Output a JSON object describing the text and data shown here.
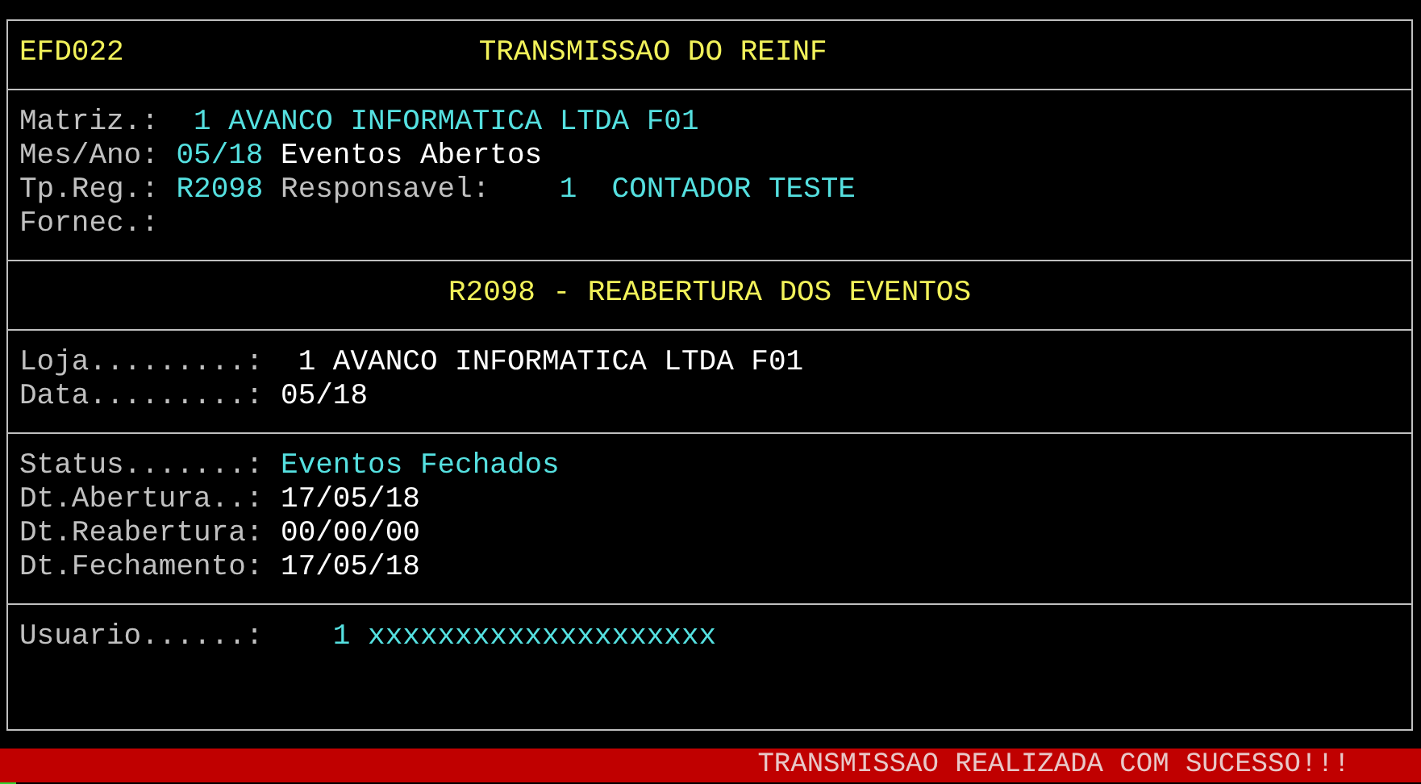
{
  "header": {
    "program_code": "EFD022",
    "title": "TRANSMISSAO DO REINF"
  },
  "sections": [
    {
      "kind": "fields",
      "lines": [
        {
          "segments": [
            {
              "kind": "label",
              "text": "Matriz.:"
            },
            {
              "kind": "highlight",
              "text": " 1 AVANCO INFORMATICA LTDA F01"
            }
          ]
        },
        {
          "segments": [
            {
              "kind": "label",
              "text": "Mes/Ano:"
            },
            {
              "kind": "highlight",
              "text": "05/18"
            },
            {
              "kind": "value",
              "text": "Eventos Abertos"
            }
          ]
        },
        {
          "segments": [
            {
              "kind": "label",
              "text": "Tp.Reg.:"
            },
            {
              "kind": "highlight",
              "text": "R2098"
            },
            {
              "kind": "label",
              "text": "Responsavel:"
            },
            {
              "kind": "highlight",
              "text": "   1  CONTADOR TESTE"
            }
          ]
        },
        {
          "segments": [
            {
              "kind": "label",
              "text": "Fornec.:"
            }
          ]
        }
      ]
    },
    {
      "kind": "heading",
      "text": "R2098 - REABERTURA DOS EVENTOS"
    },
    {
      "kind": "fields",
      "lines": [
        {
          "segments": [
            {
              "kind": "label",
              "text": "Loja.........:"
            },
            {
              "kind": "value",
              "text": " 1 AVANCO INFORMATICA LTDA F01"
            }
          ]
        },
        {
          "segments": [
            {
              "kind": "label",
              "text": "Data.........:"
            },
            {
              "kind": "value",
              "text": "05/18"
            }
          ]
        }
      ]
    },
    {
      "kind": "fields",
      "lines": [
        {
          "segments": [
            {
              "kind": "label",
              "text": "Status.......:"
            },
            {
              "kind": "highlight",
              "text": "Eventos Fechados"
            }
          ]
        },
        {
          "segments": [
            {
              "kind": "label",
              "text": "Dt.Abertura..:"
            },
            {
              "kind": "value",
              "text": "17/05/18"
            }
          ]
        },
        {
          "segments": [
            {
              "kind": "label",
              "text": "Dt.Reabertura:"
            },
            {
              "kind": "value",
              "text": "00/00/00"
            }
          ]
        },
        {
          "segments": [
            {
              "kind": "label",
              "text": "Dt.Fechamento:"
            },
            {
              "kind": "value",
              "text": "17/05/18"
            }
          ]
        }
      ]
    },
    {
      "kind": "fields",
      "lines": [
        {
          "segments": [
            {
              "kind": "label",
              "text": "Usuario......:"
            },
            {
              "kind": "highlight",
              "text": "   1 xxxxxxxxxxxxxxxxxxxx"
            }
          ]
        }
      ]
    }
  ],
  "status_message": "TRANSMISSAO REALIZADA COM SUCESSO!!!"
}
